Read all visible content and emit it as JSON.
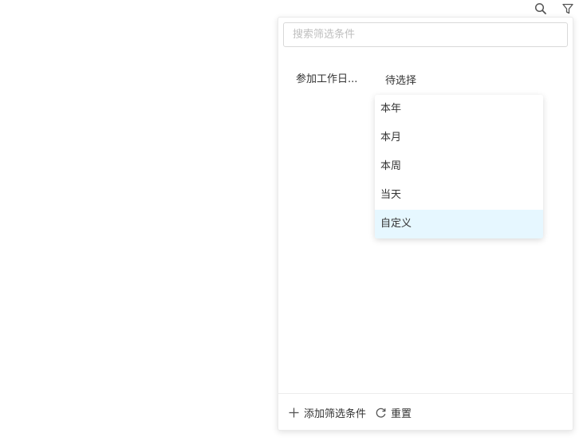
{
  "toolbar": {
    "search_icon": "search-icon",
    "filter_icon": "filter-icon"
  },
  "panel": {
    "search": {
      "placeholder": "搜索筛选条件",
      "value": ""
    },
    "condition": {
      "label": "参加工作日...",
      "value": "待选择"
    },
    "dropdown": {
      "options": [
        "本年",
        "本月",
        "本周",
        "当天",
        "自定义"
      ],
      "highlighted": "自定义"
    },
    "footer": {
      "add_label": "添加筛选条件",
      "reset_label": "重置"
    }
  },
  "colors": {
    "highlight_bg": "#e6f7ff",
    "text": "#333333",
    "placeholder": "#bfbfbf",
    "border": "#d9d9d9"
  }
}
